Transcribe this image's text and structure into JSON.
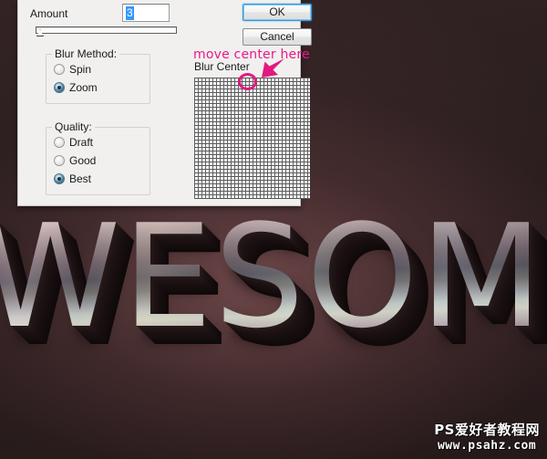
{
  "dialog": {
    "amount": {
      "label": "Amount",
      "value": "3",
      "slider_position_percent": 2
    },
    "buttons": {
      "ok": "OK",
      "cancel": "Cancel"
    },
    "blur_method": {
      "title": "Blur Method:",
      "options": [
        {
          "label": "Spin",
          "selected": false
        },
        {
          "label": "Zoom",
          "selected": true
        }
      ]
    },
    "quality": {
      "title": "Quality:",
      "options": [
        {
          "label": "Draft",
          "selected": false
        },
        {
          "label": "Good",
          "selected": false
        },
        {
          "label": "Best",
          "selected": true
        }
      ]
    },
    "blur_center": {
      "label": "Blur Center",
      "grid_rows": 4,
      "grid_cols": 4
    }
  },
  "annotation": {
    "text": "move center here",
    "color": "#e8198b",
    "arrow": "arrow-down-left",
    "target": "blur-center-point"
  },
  "artwork": {
    "text": "WESOME",
    "style": "metallic-3d-extruded"
  },
  "watermark": {
    "line1": "PS爱好者教程网",
    "line2": "www.psahz.com"
  },
  "colors": {
    "background": "#2c1f20",
    "dialog_background": "#f1f0ef",
    "accent_pink": "#e0197f",
    "selection_blue": "#3399ff",
    "focus_blue": "#3c9ad6"
  }
}
